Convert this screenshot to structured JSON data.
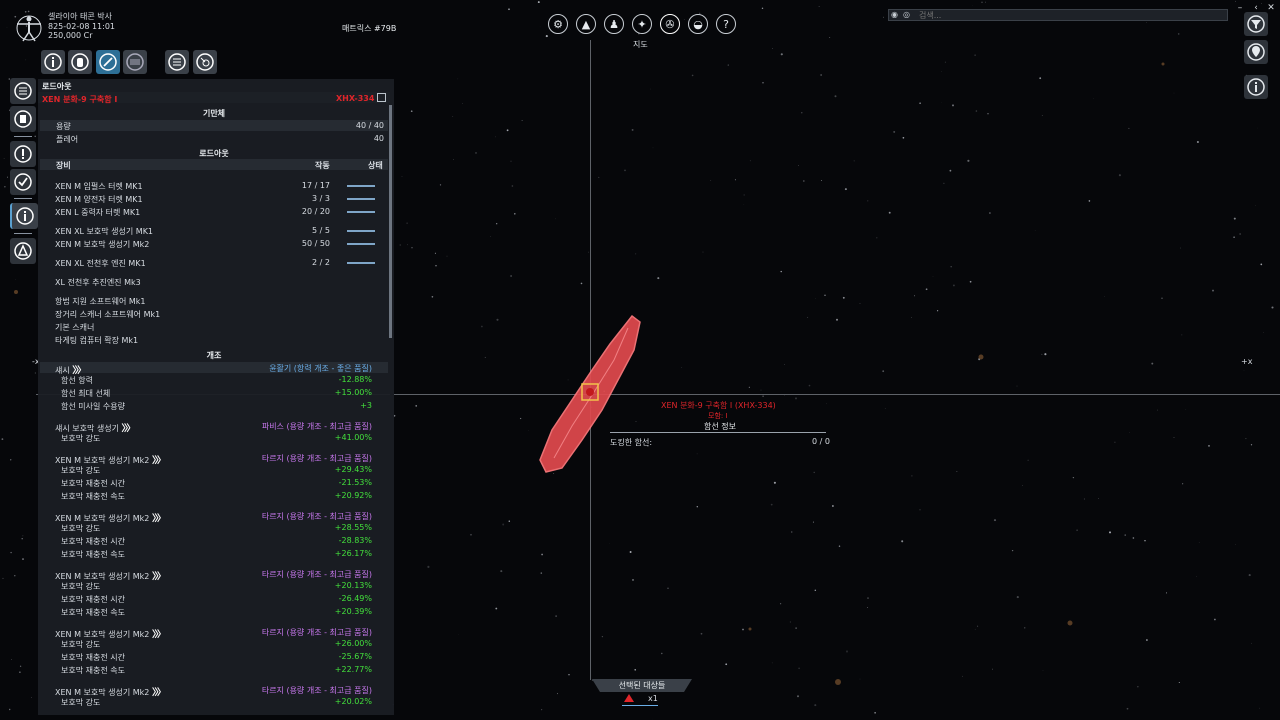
{
  "player": {
    "name": "셀라이아 태콘 박사",
    "datetime": "825-02-08 11:01",
    "credits": "250,000 Cr"
  },
  "matrix_label": "매트릭스 #79B",
  "top_menu": {
    "icons": [
      "gear-icon",
      "pyramid-icon",
      "person-icon",
      "walk-icon",
      "map-compass-icon",
      "helmet-icon",
      "help-icon"
    ],
    "active_label": "지도"
  },
  "search": {
    "placeholder": "검색..."
  },
  "panel": {
    "title": "로드아웃",
    "ship_name": "XEN 분화-9 구축함 I",
    "ship_code": "XHX-334",
    "hull_header": "기만체",
    "hull_rows": [
      {
        "label": "용량",
        "value": "40 / 40"
      },
      {
        "label": "플레어",
        "value": "40"
      }
    ],
    "loadout_header": "로드아웃",
    "col_equipment": "장비",
    "col_operational": "작동",
    "col_status": "상태",
    "equipment": [
      {
        "name": "XEN M 임펄스 터렛 MK1",
        "count": "17 / 17",
        "status": 1
      },
      {
        "name": "XEN M 양전자 터렛 MK1",
        "count": "3 / 3",
        "status": 1
      },
      {
        "name": "XEN L 중력자 터렛 MK1",
        "count": "20 / 20",
        "status": 1
      },
      {
        "name": "XEN XL 보호막 생성기 MK1",
        "count": "5 / 5",
        "status": 1
      },
      {
        "name": "XEN M 보호막 생성기 Mk2",
        "count": "50 / 50",
        "status": 1
      },
      {
        "name": "XEN XL 전천후 엔진 MK1",
        "count": "2 / 2",
        "status": 1
      },
      {
        "name": "XL 전천후 추진엔진 Mk3",
        "count": "",
        "status": 0
      },
      {
        "name": "항법 지원 소프트웨어 Mk1",
        "count": "",
        "status": 0
      },
      {
        "name": "장거리 스캐너 소프트웨어 Mk1",
        "count": "",
        "status": 0
      },
      {
        "name": "기본 스캐너",
        "count": "",
        "status": 0
      },
      {
        "name": "타게팅 컴퓨터 확장 Mk1",
        "count": "",
        "status": 0
      }
    ],
    "mods_header": "개조",
    "mods": [
      {
        "name": "섀시",
        "mod": "윤활기 (항력 개조 - 좋은 품질)",
        "color": "blue",
        "stats": [
          {
            "label": "함선 항력",
            "value": "-12.88%"
          },
          {
            "label": "함선 최대 선체",
            "value": "+15.00%"
          },
          {
            "label": "함선 미사일 수용량",
            "value": "+3"
          }
        ]
      },
      {
        "name": "섀시 보호막 생성기",
        "mod": "파비스 (용량 개조 - 최고급 품질)",
        "color": "purple",
        "stats": [
          {
            "label": "보호막 강도",
            "value": "+41.00%"
          }
        ]
      },
      {
        "name": "XEN M 보호막 생성기 Mk2",
        "mod": "타르지 (용량 개조 - 최고급 품질)",
        "color": "purple",
        "stats": [
          {
            "label": "보호막 강도",
            "value": "+29.43%"
          },
          {
            "label": "보호막 재충전 시간",
            "value": "-21.53%"
          },
          {
            "label": "보호막 재충전 속도",
            "value": "+20.92%"
          }
        ]
      },
      {
        "name": "XEN M 보호막 생성기 Mk2",
        "mod": "타르지 (용량 개조 - 최고급 품질)",
        "color": "purple",
        "stats": [
          {
            "label": "보호막 강도",
            "value": "+28.55%"
          },
          {
            "label": "보호막 재충전 시간",
            "value": "-28.83%"
          },
          {
            "label": "보호막 재충전 속도",
            "value": "+26.17%"
          }
        ]
      },
      {
        "name": "XEN M 보호막 생성기 Mk2",
        "mod": "타르지 (용량 개조 - 최고급 품질)",
        "color": "purple",
        "stats": [
          {
            "label": "보호막 강도",
            "value": "+20.13%"
          },
          {
            "label": "보호막 재충전 시간",
            "value": "-26.49%"
          },
          {
            "label": "보호막 재충전 속도",
            "value": "+20.39%"
          }
        ]
      },
      {
        "name": "XEN M 보호막 생성기 Mk2",
        "mod": "타르지 (용량 개조 - 최고급 품질)",
        "color": "purple",
        "stats": [
          {
            "label": "보호막 강도",
            "value": "+26.00%"
          },
          {
            "label": "보호막 재충전 시간",
            "value": "-25.67%"
          },
          {
            "label": "보호막 재충전 속도",
            "value": "+22.77%"
          }
        ]
      },
      {
        "name": "XEN M 보호막 생성기 Mk2",
        "mod": "타르지 (용량 개조 - 최고급 품질)",
        "color": "purple",
        "stats": [
          {
            "label": "보호막 강도",
            "value": "+20.02%"
          }
        ]
      }
    ]
  },
  "map": {
    "axis_left": "-x",
    "axis_right": "+x",
    "ship_label": "XEN 분화-9 구축함 I (XHX-334)",
    "ship_sub": "모함: I",
    "info_title": "함선 정보",
    "docked_label": "도킹한 함선:",
    "docked_value": "0 / 0"
  },
  "selected": {
    "title": "선택된 대상들",
    "count": "x1"
  },
  "colors": {
    "hostile": "#e0252a",
    "positive": "#43e03c",
    "mod_blue": "#6aaee8",
    "mod_purple": "#c878ee",
    "accent": "#2d6f96"
  }
}
